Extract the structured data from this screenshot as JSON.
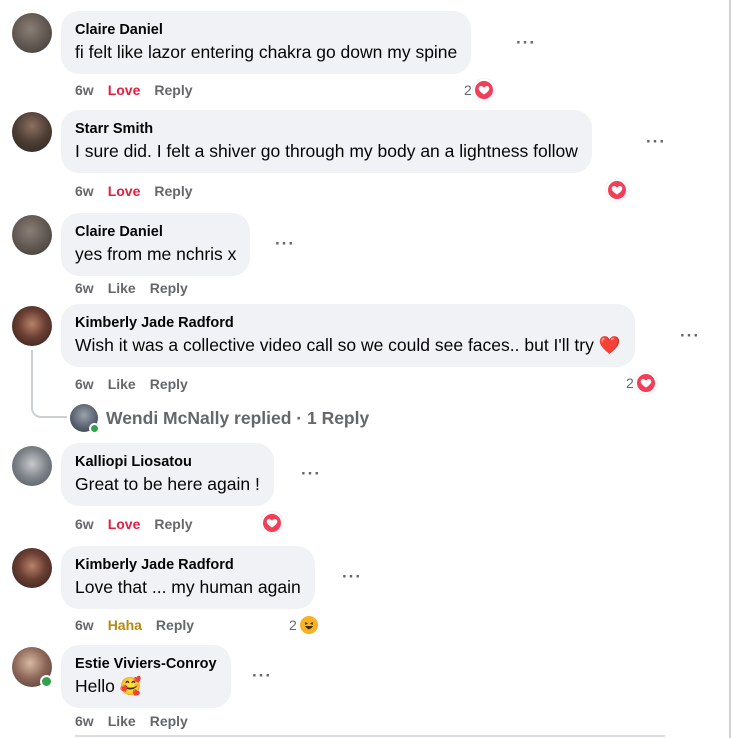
{
  "comments": [
    {
      "name": "Claire Daniel",
      "text": "fi felt like lazor entering chakra go down my spine",
      "time": "6w",
      "reaction_action": "Love",
      "reply": "Reply",
      "reaction_count": "2",
      "reaction_icon": "heart-icon"
    },
    {
      "name": "Starr Smith",
      "text": "I sure did. I felt a shiver go through my body an a lightness follow",
      "time": "6w",
      "reaction_action": "Love",
      "reply": "Reply",
      "reaction_count": "",
      "reaction_icon": "heart-icon"
    },
    {
      "name": "Claire Daniel",
      "text": "yes from me nchris x",
      "time": "6w",
      "reaction_action": "Like",
      "reply": "Reply"
    },
    {
      "name": "Kimberly Jade Radford",
      "text": "Wish it was a collective video call so we could see faces.. but I'll try",
      "text_emoji": "❤️",
      "time": "6w",
      "reaction_action": "Like",
      "reply": "Reply",
      "reaction_count": "2",
      "reaction_icon": "heart-icon"
    },
    {
      "name": "Kalliopi Liosatou",
      "text": "Great to be here again !",
      "time": "6w",
      "reaction_action": "Love",
      "reply": "Reply",
      "reaction_count": "",
      "reaction_icon": "heart-icon"
    },
    {
      "name": "Kimberly Jade Radford",
      "text": "Love that ... my human again",
      "time": "6w",
      "reaction_action": "Haha",
      "reply": "Reply",
      "reaction_count": "2",
      "reaction_icon": "haha-icon"
    },
    {
      "name": "Estie Viviers-Conroy",
      "text": "Hello",
      "text_emoji": "🥰",
      "time": "6w",
      "reaction_action": "Like",
      "reply": "Reply"
    }
  ],
  "replies": {
    "text": "Wendi McNally replied · 1 Reply"
  },
  "more_label": "···",
  "colors": {
    "love": "#e41e3f",
    "haha": "#b48a10",
    "bubble": "#f0f2f5",
    "online": "#31a24c"
  }
}
